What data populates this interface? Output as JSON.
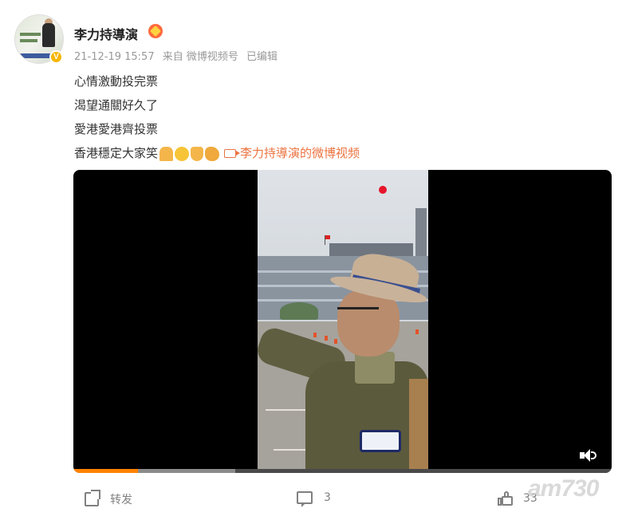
{
  "post": {
    "author": "李力持導演",
    "verified_badge": "V",
    "meta": {
      "time": "21-12-19 15:57",
      "source": "来自 微博视频号",
      "edited": "已编辑"
    },
    "lines": [
      "心情激動投完票",
      "渴望通關好久了",
      "愛港愛港齊投票",
      "香港穩定大家笑"
    ],
    "emojis": [
      "pray-emoji",
      "smile-emoji",
      "thumbs-up-emoji",
      "clap-emoji"
    ],
    "video_link_label": "李力持導演的微博视频"
  },
  "player": {
    "progress_fraction": 0.12,
    "buffered_fraction": 0.3,
    "accent": "#ff8200"
  },
  "actions": {
    "repost_label": "转发",
    "comment_count": "3",
    "like_count": "33"
  },
  "watermark": "am730",
  "colors": {
    "link": "#eb7340",
    "verified": "#f7b500",
    "muted": "#999999"
  }
}
